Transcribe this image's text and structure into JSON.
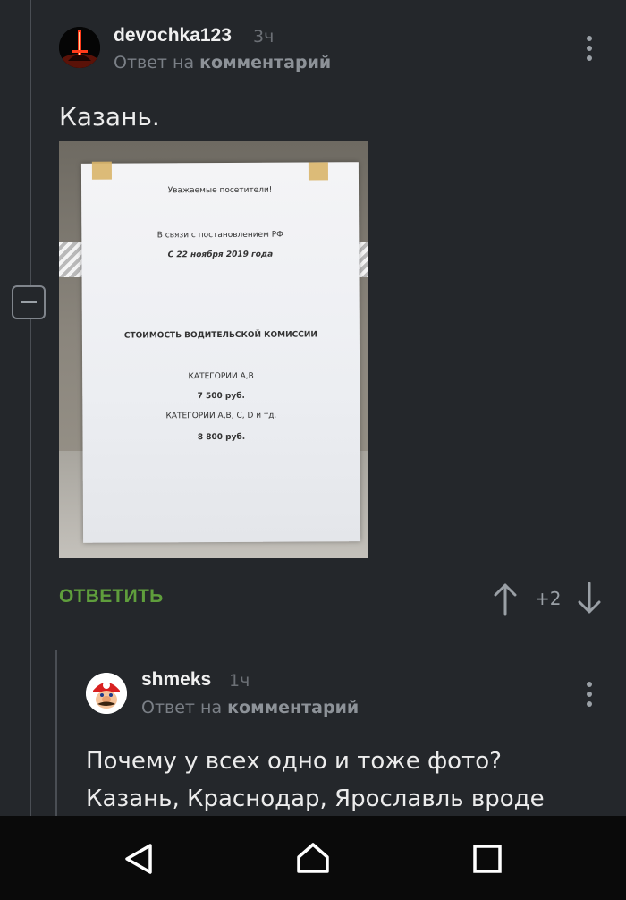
{
  "comment1": {
    "username": "devochka123",
    "time": "3ч",
    "reply_prefix": "Ответ на",
    "reply_target": "комментарий",
    "text": "Казань.",
    "photo": {
      "line1": "Уважаемые посетители!",
      "line2": "В связи с постановлением РФ",
      "line3": "С 22 ноября 2019 года",
      "line4": "СТОИМОСТЬ ВОДИТЕЛЬСКОЙ КОМИССИИ",
      "line5": "КАТЕГОРИИ А,В",
      "line6": "7 500 руб.",
      "line7": "КАТЕГОРИИ А,В, С, D и тд.",
      "line8": "8 800 руб."
    },
    "reply_button": "ОТВЕТИТЬ",
    "score": "+2"
  },
  "comment2": {
    "username": "shmeks",
    "time": "1ч",
    "reply_prefix": "Ответ на",
    "reply_target": "комментарий",
    "text_line1": "Почему у всех одно и тоже фото?",
    "text_line2": "Казань, Краснодар, Ярославль вроде"
  },
  "icons": [
    "collapse-icon",
    "kebab-menu-icon",
    "arrow-up-icon",
    "arrow-down-icon",
    "back-icon",
    "home-icon",
    "recents-icon"
  ],
  "colors": {
    "background": "#24272b",
    "accent_green": "#5f9e3c",
    "navbar": "#0a0a0a"
  }
}
